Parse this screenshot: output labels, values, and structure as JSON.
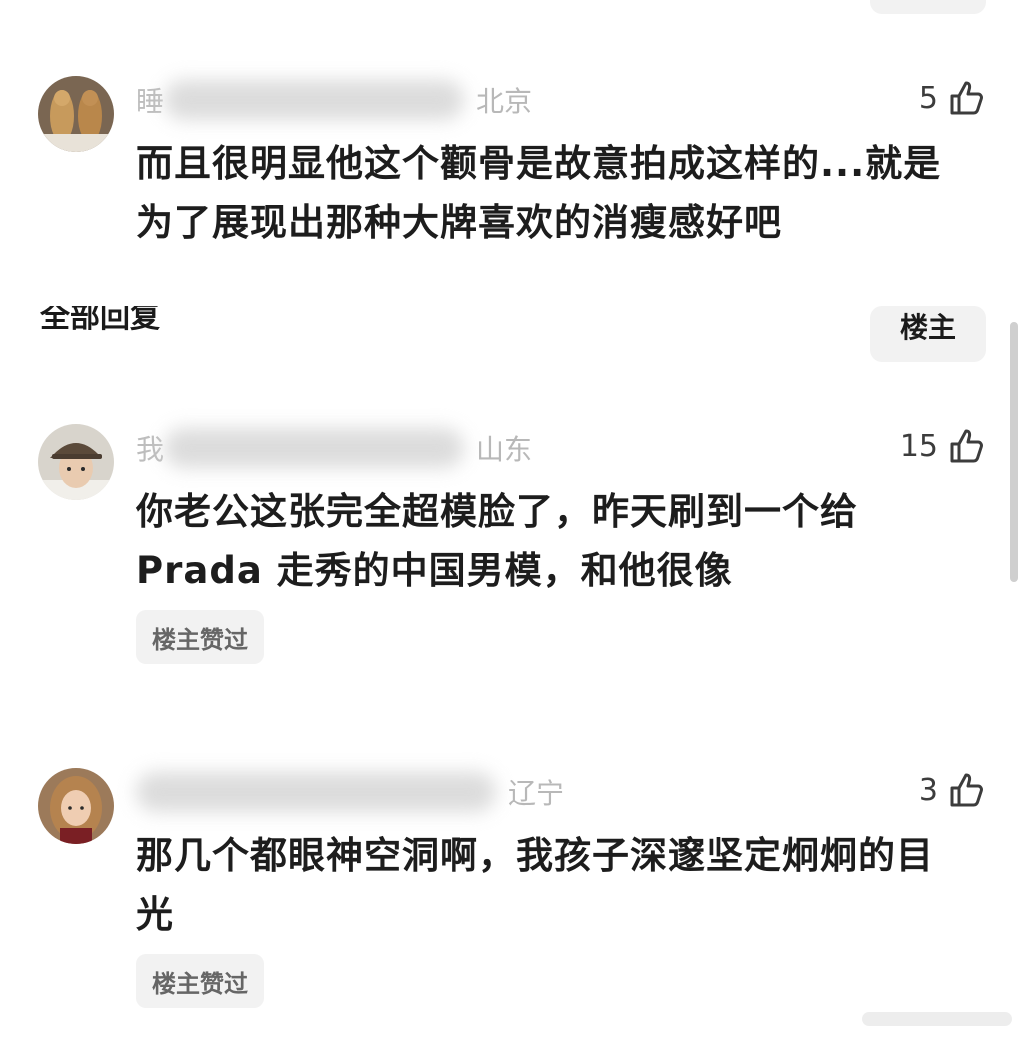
{
  "comments": [
    {
      "user_visible": "睡",
      "location": "北京",
      "likes": "5",
      "text_line1": "而且很明显他这个颧骨是故意拍成这样的...就是",
      "text_line2": "为了展现出那种大牌喜欢的消瘦感好吧",
      "badge": ""
    },
    {
      "user_visible": "我",
      "location": "山东",
      "likes": "15",
      "text_line1": "你老公这张完全超模脸了，昨天刷到一个给",
      "text_line2": "Prada 走秀的中国男模，和他很像",
      "badge": "楼主赞过"
    },
    {
      "user_visible": "",
      "location": "辽宁",
      "likes": "3",
      "text_line1": "那几个都眼神空洞啊，我孩子深邃坚定炯炯的目",
      "text_line2": "光",
      "badge": "楼主赞过"
    }
  ],
  "section": {
    "title": "全部回复",
    "host_filter": "楼主"
  },
  "icons": {
    "like": "thumbs-up-icon"
  },
  "colors": {
    "text": "#1d1d1d",
    "muted": "#bdbdbd",
    "chip_bg": "#f2f2f2"
  }
}
